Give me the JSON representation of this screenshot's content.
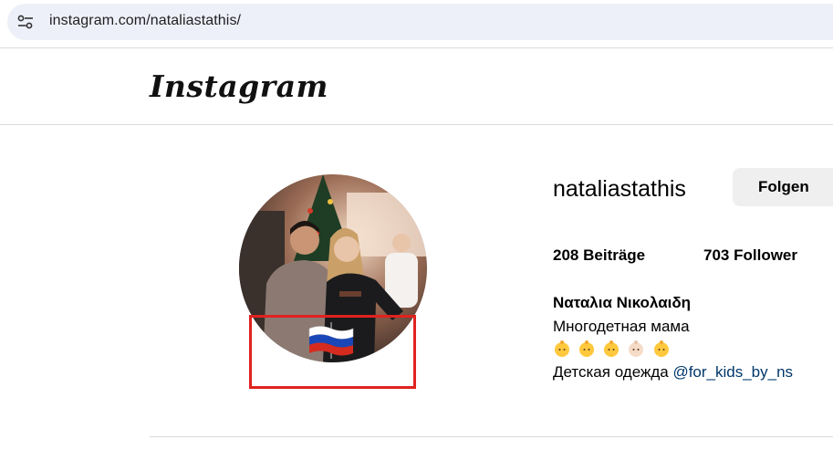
{
  "browser": {
    "url": "instagram.com/nataliastathis/",
    "site_info_icon": "tune-icon"
  },
  "header": {
    "logo_text": "Instagram"
  },
  "profile": {
    "username": "nataliastathis",
    "follow_label": "Folgen",
    "posts_count": "208",
    "posts_label": "Beiträge",
    "followers_count": "703",
    "followers_label": "Follower",
    "full_name": "Ναταλια Νικολαιδη",
    "bio_line1": "Многодетная мама",
    "bio_emojis": [
      "baby-emoji",
      "baby-emoji",
      "baby-emoji",
      "baby-emoji-light",
      "baby-emoji"
    ],
    "bio_line3_text": "Детская одежда",
    "bio_line3_mention": "@for_kids_by_ns",
    "avatar_flag": "russia-flag-icon"
  },
  "colors": {
    "highlight_box": "#e0221f",
    "mention": "#00376b",
    "button_bg": "#efefef",
    "url_bar_bg": "#eef0f9"
  }
}
